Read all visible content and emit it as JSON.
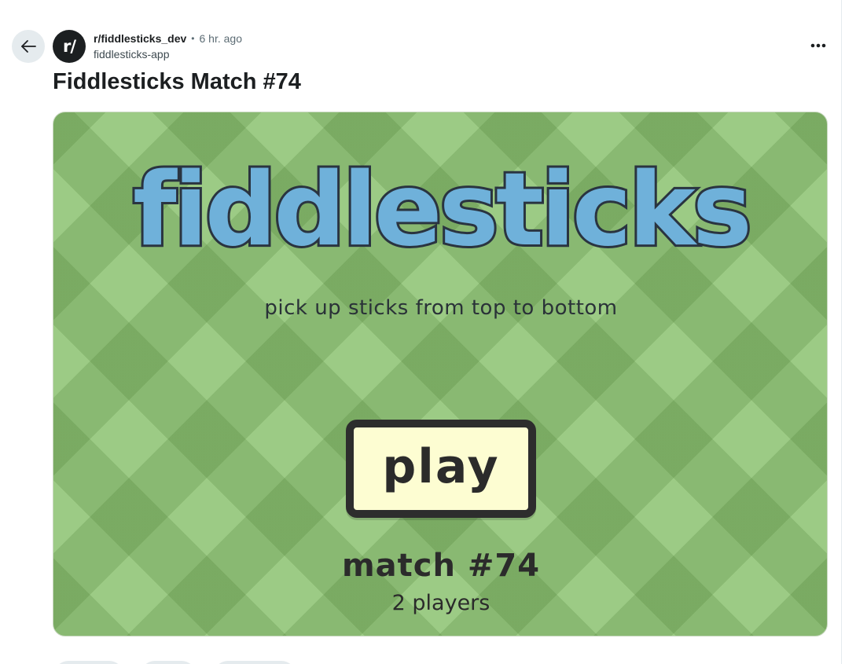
{
  "post": {
    "avatar_text": "r/",
    "subreddit": "r/fiddlesticks_dev",
    "separator": "•",
    "time_ago": "6 hr. ago",
    "author": "fiddlesticks-app",
    "title": "Fiddlesticks Match #74"
  },
  "game": {
    "logo": "fiddlesticks",
    "tagline": "pick up sticks from top to bottom",
    "play_label": "play",
    "match_label": "match #74",
    "players_label": "2 players",
    "colors": {
      "background": "#9ccb85",
      "logo_fill": "#6fb1da",
      "outline": "#2a3440",
      "button_fill": "#fdfdd2"
    }
  },
  "icons": {
    "back": "arrow-left-icon",
    "more": "overflow-menu-icon"
  }
}
